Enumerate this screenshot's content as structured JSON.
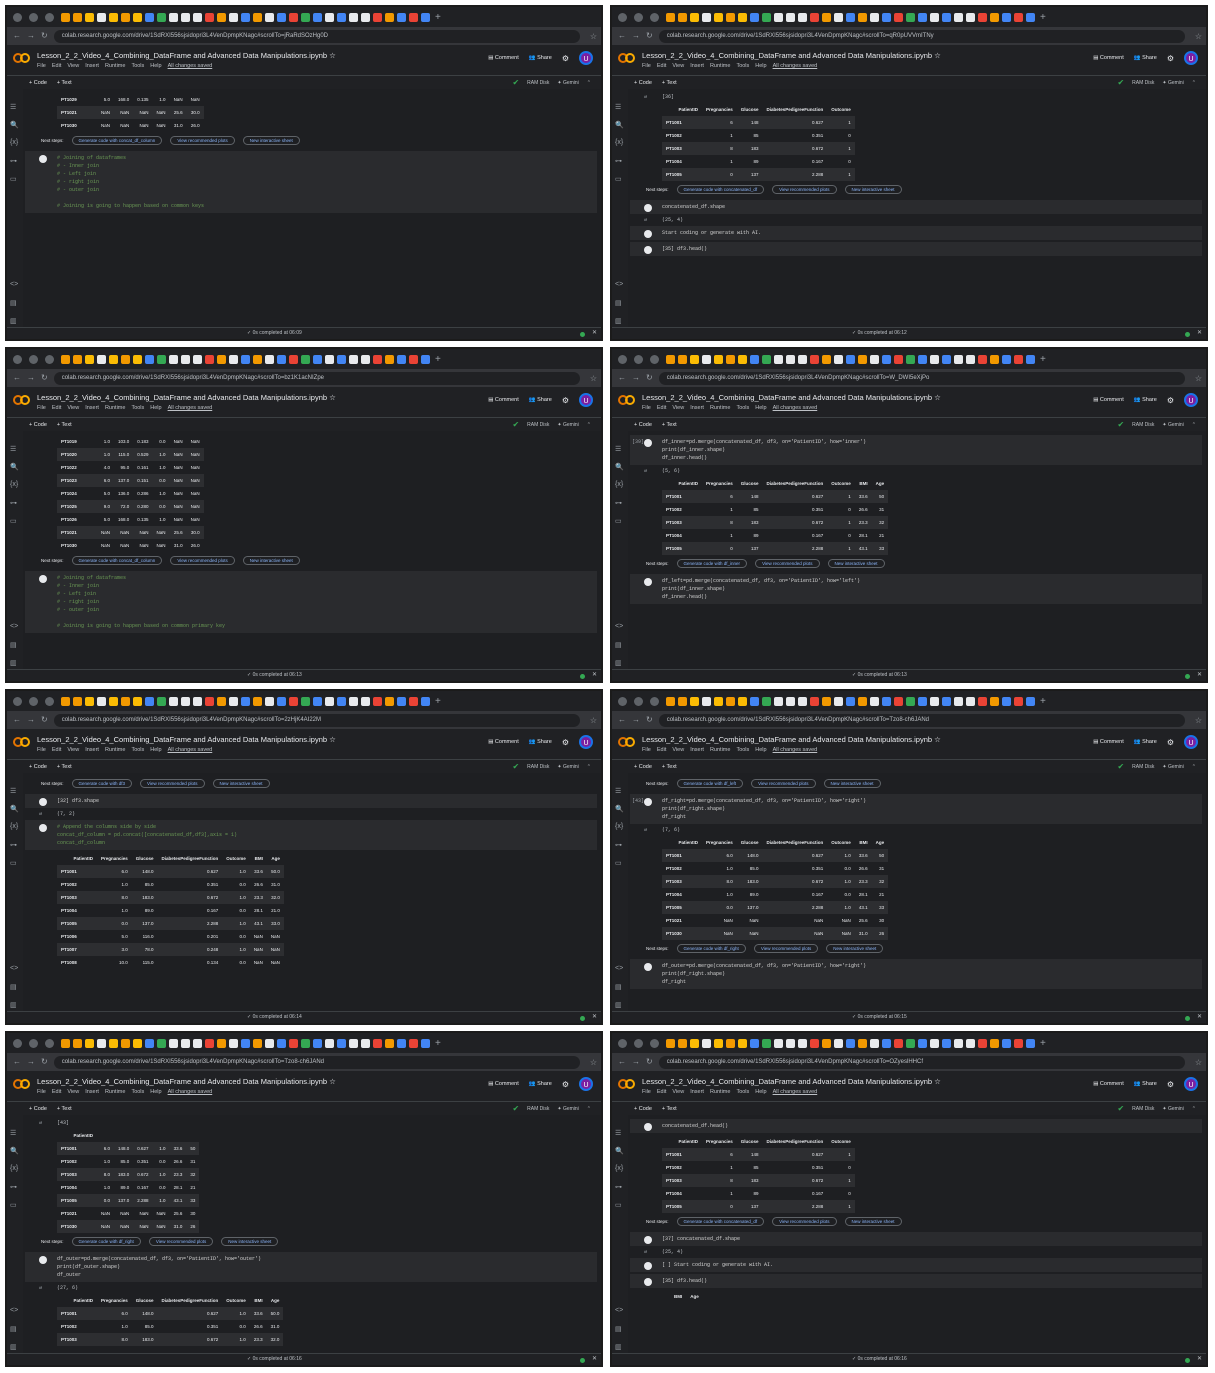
{
  "common": {
    "notebook_title": "Lesson_2_2_Video_4_Combining_DataFrame and Advanced Data Manipulations.ipynb",
    "menus": [
      "File",
      "Edit",
      "View",
      "Insert",
      "Runtime",
      "Tools",
      "Help"
    ],
    "saved_label": "All changes saved",
    "comment_label": "Comment",
    "share_label": "Share",
    "user_initial": "U",
    "add_code": "+ Code",
    "add_text": "+ Text",
    "ram_disk": "RAM Disk",
    "gemini": "Gemini",
    "status_prefix": "0s",
    "gen_code_prefix": "Generate code with",
    "view_plots": "View recommended plots",
    "new_sheet": "New interactive sheet",
    "next_steps": "Next steps:",
    "accent": "#8ab4f8"
  },
  "panels": [
    {
      "url": "colab.research.google.com/drive/1SdRXI556sjsidopri3L4VenDpmpKNagc#scrollTo=jRaRdSOzHg0D",
      "status": "completed at 06:09",
      "table": {
        "cols": [
          "",
          "",
          "",
          "",
          "",
          "",
          ""
        ],
        "rows": [
          [
            "PT1029",
            "5.0",
            "168.0",
            "0.135",
            "1.0",
            "NaN",
            "NaN"
          ],
          [
            "PT1021",
            "NaN",
            "NaN",
            "NaN",
            "NaN",
            "25.6",
            "30.0"
          ],
          [
            "PT1030",
            "NaN",
            "NaN",
            "NaN",
            "NaN",
            "31.0",
            "26.0"
          ]
        ]
      },
      "gen_var": "concat_df_column",
      "code": "# Joining of dataframes\n# - Inner join\n# - Left join\n# - right join\n# - outer join\n\n# Joining is going to happen based on common keys"
    },
    {
      "url": "colab.research.google.com/drive/1SdRXI556sjsidopri3L4VenDpmpKNagc#scrollTo=qR0pUVVmITNy",
      "status": "completed at 06:12",
      "cell_num": "[36]",
      "table": {
        "cols": [
          "PatientID",
          "Pregnancies",
          "Glucose",
          "DiabetesPedigreeFunction",
          "Outcome"
        ],
        "rows": [
          [
            "PT1001",
            "6",
            "148",
            "0.627",
            "1"
          ],
          [
            "PT1002",
            "1",
            "85",
            "0.351",
            "0"
          ],
          [
            "PT1003",
            "8",
            "183",
            "0.672",
            "1"
          ],
          [
            "PT1004",
            "1",
            "89",
            "0.167",
            "0"
          ],
          [
            "PT1005",
            "0",
            "137",
            "2.288",
            "1"
          ]
        ]
      },
      "gen_var": "concatenated_df",
      "code": "concatenated_df.shape",
      "out": "(25, 4)",
      "placeholder": "Start coding or generate with AI.",
      "code2": "[35] df3.head()"
    },
    {
      "url": "colab.research.google.com/drive/1SdRXI556sjsidopri3L4VenDpmpKNagc#scrollTo=bz1K1acNIZpe",
      "status": "completed at 06:13",
      "table": {
        "cols": [
          "",
          "",
          "",
          "",
          "",
          "",
          ""
        ],
        "rows": [
          [
            "PT1019",
            "1.0",
            "103.0",
            "0.183",
            "0.0",
            "NaN",
            "NaN"
          ],
          [
            "PT1020",
            "1.0",
            "115.0",
            "0.529",
            "1.0",
            "NaN",
            "NaN"
          ],
          [
            "PT1022",
            "4.0",
            "95.0",
            "0.161",
            "1.0",
            "NaN",
            "NaN"
          ],
          [
            "PT1023",
            "6.0",
            "137.0",
            "0.151",
            "0.0",
            "NaN",
            "NaN"
          ],
          [
            "PT1024",
            "5.0",
            "136.0",
            "0.286",
            "1.0",
            "NaN",
            "NaN"
          ],
          [
            "PT1025",
            "9.0",
            "72.0",
            "0.280",
            "0.0",
            "NaN",
            "NaN"
          ],
          [
            "PT1026",
            "5.0",
            "168.0",
            "0.135",
            "1.0",
            "NaN",
            "NaN"
          ],
          [
            "PT1021",
            "NaN",
            "NaN",
            "NaN",
            "NaN",
            "25.6",
            "30.0"
          ],
          [
            "PT1030",
            "NaN",
            "NaN",
            "NaN",
            "NaN",
            "31.0",
            "26.0"
          ]
        ]
      },
      "gen_var": "concat_df_column",
      "code": "# Joining of dataframes\n# - Inner join\n# - Left join\n# - right join\n# - outer join\n\n# Joining is going to happen based on common primary key"
    },
    {
      "url": "colab.research.google.com/drive/1SdRXI556sjsidopri3L4VenDpmpKNagc#scrollTo=W_DWI5eXjPo",
      "status": "completed at 06:13",
      "cell_num": "[39]",
      "code": "df_inner=pd.merge(concatenated_df, df3, on='PatientID', how='inner')\nprint(df_inner.shape)\ndf_inner.head()",
      "out": "(5, 6)",
      "table": {
        "cols": [
          "PatientID",
          "Pregnancies",
          "Glucose",
          "DiabetesPedigreeFunction",
          "Outcome",
          "BMI",
          "Age"
        ],
        "rows": [
          [
            "PT1001",
            "6",
            "148",
            "0.627",
            "1",
            "33.6",
            "50"
          ],
          [
            "PT1002",
            "1",
            "85",
            "0.351",
            "0",
            "26.6",
            "31"
          ],
          [
            "PT1003",
            "8",
            "183",
            "0.672",
            "1",
            "23.3",
            "32"
          ],
          [
            "PT1004",
            "1",
            "89",
            "0.167",
            "0",
            "28.1",
            "21"
          ],
          [
            "PT1005",
            "0",
            "137",
            "2.288",
            "1",
            "43.1",
            "33"
          ]
        ]
      },
      "gen_var": "df_inner",
      "code2": "df_left=pd.merge(concatenated_df, df3, on='PatientID', how='left')\nprint(df_inner.shape)\ndf_inner.head()"
    },
    {
      "url": "colab.research.google.com/drive/1SdRXI556sjsidopri3L4VenDpmpKNagc#scrollTo=2zHjK4AI22M",
      "status": "completed at 06:14",
      "gen_var": "df3",
      "code": "[32] df3.shape",
      "out": "(7, 2)",
      "code2": "# Append the columns side by side\nconcat_df_column = pd.concat([concatenated_df,df3],axis = 1)\nconcat_df_column",
      "table": {
        "cols": [
          "PatientID",
          "Pregnancies",
          "Glucose",
          "DiabetesPedigreeFunction",
          "Outcome",
          "BMI",
          "Age"
        ],
        "rows": [
          [
            "PT1001",
            "6.0",
            "148.0",
            "0.627",
            "1.0",
            "33.6",
            "50.0"
          ],
          [
            "PT1002",
            "1.0",
            "85.0",
            "0.351",
            "0.0",
            "26.6",
            "31.0"
          ],
          [
            "PT1003",
            "8.0",
            "183.0",
            "0.672",
            "1.0",
            "23.3",
            "32.0"
          ],
          [
            "PT1004",
            "1.0",
            "89.0",
            "0.167",
            "0.0",
            "28.1",
            "21.0"
          ],
          [
            "PT1005",
            "0.0",
            "137.0",
            "2.288",
            "1.0",
            "43.1",
            "33.0"
          ],
          [
            "PT1006",
            "5.0",
            "116.0",
            "0.201",
            "0.0",
            "NaN",
            "NaN"
          ],
          [
            "PT1007",
            "3.0",
            "78.0",
            "0.248",
            "1.0",
            "NaN",
            "NaN"
          ],
          [
            "PT1008",
            "10.0",
            "115.0",
            "0.134",
            "0.0",
            "NaN",
            "NaN"
          ]
        ]
      }
    },
    {
      "url": "colab.research.google.com/drive/1SdRXI556sjsidopri3L4VenDpmpKNagc#scrollTo=Tzo8-ch6JANd",
      "status": "completed at 06:15",
      "gen_var": "df_left",
      "cell_num": "[43]",
      "code": "df_right=pd.merge(concatenated_df, df3, on='PatientID', how='right')\nprint(df_right.shape)\ndf_right",
      "out": "(7, 6)",
      "table": {
        "cols": [
          "PatientID",
          "Pregnancies",
          "Glucose",
          "DiabetesPedigreeFunction",
          "Outcome",
          "BMI",
          "Age"
        ],
        "rows": [
          [
            "PT1001",
            "6.0",
            "148.0",
            "0.627",
            "1.0",
            "33.6",
            "50"
          ],
          [
            "PT1002",
            "1.0",
            "85.0",
            "0.351",
            "0.0",
            "26.6",
            "31"
          ],
          [
            "PT1003",
            "8.0",
            "183.0",
            "0.672",
            "1.0",
            "23.3",
            "32"
          ],
          [
            "PT1004",
            "1.0",
            "89.0",
            "0.167",
            "0.0",
            "28.1",
            "21"
          ],
          [
            "PT1005",
            "0.0",
            "137.0",
            "2.288",
            "1.0",
            "43.1",
            "33"
          ],
          [
            "PT1021",
            "NaN",
            "NaN",
            "NaN",
            "NaN",
            "25.6",
            "30"
          ],
          [
            "PT1030",
            "NaN",
            "NaN",
            "NaN",
            "NaN",
            "31.0",
            "26"
          ]
        ]
      },
      "gen_var2": "df_right",
      "code2": "df_outer=pd.merge(concatenated_df, df3, on='PatientID', how='right')\nprint(df_right.shape)\ndf_right"
    },
    {
      "url": "colab.research.google.com/drive/1SdRXI556sjsidopri3L4VenDpmpKNagc#scrollTo=Tzo8-ch6JANd",
      "status": "completed at 06:16",
      "cell_num": "[43]",
      "table": {
        "cols": [
          "PatientID",
          "",
          "",
          "",
          "",
          "",
          ""
        ],
        "rows": [
          [
            "PT1001",
            "6.0",
            "148.0",
            "0.627",
            "1.0",
            "33.6",
            "50"
          ],
          [
            "PT1002",
            "1.0",
            "85.0",
            "0.351",
            "0.0",
            "26.6",
            "31"
          ],
          [
            "PT1003",
            "8.0",
            "183.0",
            "0.672",
            "1.0",
            "23.3",
            "32"
          ],
          [
            "PT1004",
            "1.0",
            "89.0",
            "0.167",
            "0.0",
            "28.1",
            "21"
          ],
          [
            "PT1005",
            "0.0",
            "137.0",
            "2.288",
            "1.0",
            "43.1",
            "33"
          ],
          [
            "PT1021",
            "NaN",
            "NaN",
            "NaN",
            "NaN",
            "25.6",
            "30"
          ],
          [
            "PT1030",
            "NaN",
            "NaN",
            "NaN",
            "NaN",
            "31.0",
            "26"
          ]
        ]
      },
      "gen_var": "df_right",
      "code2": "df_outer=pd.merge(concatenated_df, df3, on='PatientID', how='outer')\nprint(df_outer.shape)\ndf_outer",
      "out": "(27, 6)",
      "table2": {
        "cols": [
          "PatientID",
          "Pregnancies",
          "Glucose",
          "DiabetesPedigreeFunction",
          "Outcome",
          "BMI",
          "Age"
        ],
        "rows": [
          [
            "PT1001",
            "6.0",
            "148.0",
            "0.627",
            "1.0",
            "33.6",
            "50.0"
          ],
          [
            "PT1002",
            "1.0",
            "85.0",
            "0.351",
            "0.0",
            "26.6",
            "31.0"
          ],
          [
            "PT1003",
            "8.0",
            "183.0",
            "0.672",
            "1.0",
            "23.3",
            "32.0"
          ]
        ]
      }
    },
    {
      "url": "colab.research.google.com/drive/1SdRXI556sjsidopri3L4VenDpmpKNagc#scrollTo=OZyeslHHCf",
      "status": "completed at 06:16",
      "code": "concatenated_df.head()",
      "table": {
        "cols": [
          "PatientID",
          "Pregnancies",
          "Glucose",
          "DiabetesPedigreeFunction",
          "Outcome"
        ],
        "rows": [
          [
            "PT1001",
            "6",
            "148",
            "0.627",
            "1"
          ],
          [
            "PT1002",
            "1",
            "85",
            "0.351",
            "0"
          ],
          [
            "PT1003",
            "8",
            "183",
            "0.672",
            "1"
          ],
          [
            "PT1004",
            "1",
            "89",
            "0.167",
            "0"
          ],
          [
            "PT1005",
            "0",
            "137",
            "2.288",
            "1"
          ]
        ]
      },
      "gen_var": "concatenated_df",
      "code2": "[37] concatenated_df.shape",
      "out": "(25, 4)",
      "placeholder": "[ ] Start coding or generate with AI.",
      "code3": "[35] df3.head()",
      "table2": {
        "cols": [
          "",
          "BMI",
          "Age"
        ],
        "rows": []
      }
    }
  ]
}
